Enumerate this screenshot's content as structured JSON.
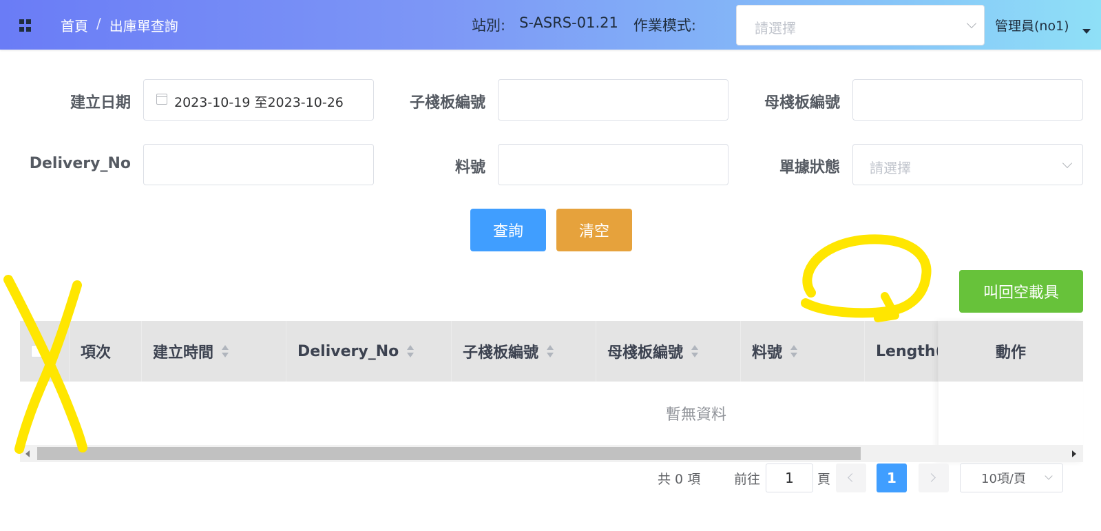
{
  "header": {
    "breadcrumb": {
      "home": "首頁",
      "separator": "/",
      "current": "出庫單查詢"
    },
    "station_label": "站別:",
    "station_value": "S-ASRS-01.21",
    "mode_label": "作業模式:",
    "mode_placeholder": "請選擇",
    "user": "管理員(no1)"
  },
  "form": {
    "created_date_label": "建立日期",
    "created_date_value": "2023-10-19 至2023-10-26",
    "child_pallet_label": "子棧板編號",
    "child_pallet_value": "",
    "parent_pallet_label": "母棧板編號",
    "parent_pallet_value": "",
    "delivery_label": "Delivery_No",
    "delivery_value": "",
    "part_no_label": "料號",
    "part_no_value": "",
    "status_label": "單據狀態",
    "status_placeholder": "請選擇"
  },
  "buttons": {
    "query": "查詢",
    "clear": "清空",
    "recall_empty_carrier": "叫回空載具"
  },
  "table": {
    "columns": [
      "項次",
      "建立時間",
      "Delivery_No",
      "子棧板編號",
      "母棧板編號",
      "料號",
      "Length(c"
    ],
    "action_column": "動作",
    "empty_text": "暫無資料"
  },
  "pagination": {
    "total": "共 0 項",
    "goto_prefix": "前往",
    "goto_value": "1",
    "goto_suffix": "頁",
    "current_page": "1",
    "page_size": "10項/頁"
  },
  "colors": {
    "header_gradient_start": "#6a7cf6",
    "header_gradient_end": "#8fe0f7",
    "primary": "#409eff",
    "warning": "#e6a23c",
    "success": "#67c23a",
    "annotation": "#ffe600"
  },
  "icons": [
    "grid-menu-icon",
    "calendar-icon",
    "chevron-down-icon",
    "caret-down-icon",
    "sort-icon",
    "chevron-left-icon",
    "chevron-right-icon"
  ]
}
